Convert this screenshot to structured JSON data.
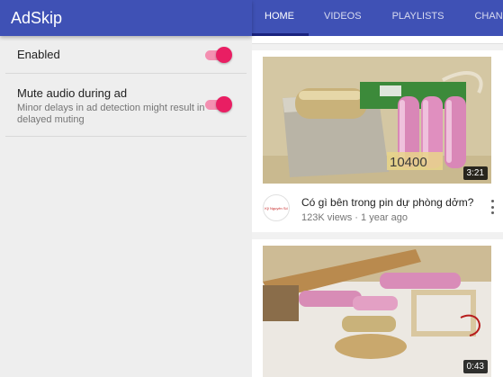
{
  "settings_app": {
    "title": "AdSkip",
    "accent_color": "#e91e63",
    "toolbar_color": "#3f51b5",
    "preferences": [
      {
        "title": "Enabled",
        "summary": "",
        "enabled": true
      },
      {
        "title": "Mute audio during ad",
        "summary": "Minor delays in ad detection might result in delayed muting",
        "enabled": true
      }
    ]
  },
  "youtube": {
    "tabs": [
      {
        "label": "HOME",
        "active": true
      },
      {
        "label": "VIDEOS",
        "active": false
      },
      {
        "label": "PLAYLISTS",
        "active": false
      },
      {
        "label": "CHANNELS",
        "active": false
      }
    ],
    "videos": [
      {
        "duration": "3:21",
        "title": "Có gì bên trong pin dự phòng dởm?",
        "meta": "123K views · 1 year ago",
        "channel_avatar_text": "Kỹ Nguyên Số",
        "thumbnail_text": "10400",
        "thumbnail_subject": "power-bank-batteries"
      },
      {
        "duration": "0:43",
        "thumbnail_subject": "batteries-hammer-sand"
      }
    ]
  }
}
